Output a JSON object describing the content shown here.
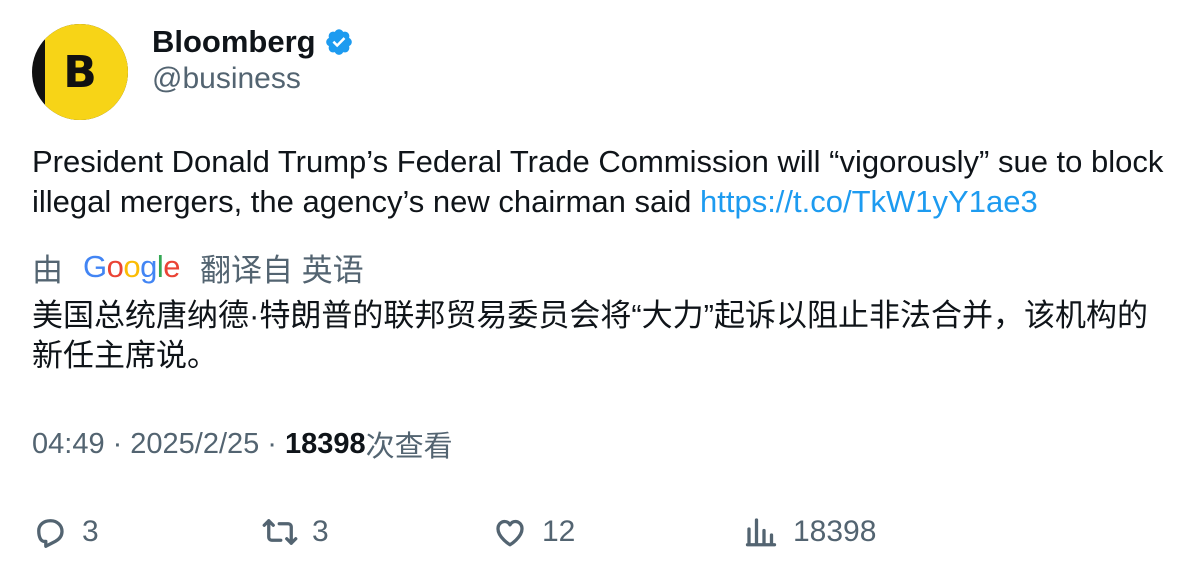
{
  "author": {
    "display_name": "Bloomberg",
    "handle": "@business",
    "avatar_letter": "B",
    "verified_icon": "verified-badge-icon",
    "brand_color": "#f7d417"
  },
  "tweet": {
    "text": "President Donald Trump’s Federal Trade Commission will “vigorously” sue to block illegal mergers, the agency’s new chairman said ",
    "link": "https://t.co/TkW1yY1ae3"
  },
  "translation": {
    "prefix": "由",
    "provider": "Google",
    "suffix": "翻译自 英语",
    "text": "美国总统唐纳德·特朗普的联邦贸易委员会将“大力”起诉以阻止非法合并，该机构的新任主席说。"
  },
  "meta": {
    "time": "04:49",
    "separator": "·",
    "date": "2025/2/25",
    "views_count": "18398",
    "views_label": "次查看"
  },
  "actions": {
    "replies": "3",
    "retweets": "3",
    "likes": "12",
    "views": "18398"
  },
  "colors": {
    "link": "#1d9bf0",
    "secondary_text": "#536471",
    "primary_text": "#0f1419",
    "verified": "#1d9bf0"
  }
}
